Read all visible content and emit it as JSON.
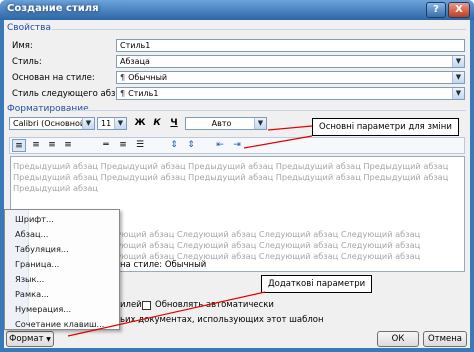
{
  "window": {
    "title": "Создание стиля",
    "help_label": "?",
    "close_label": "X"
  },
  "properties": {
    "section_title": "Свойства",
    "name_label": "Имя:",
    "name_value": "Стиль1",
    "type_label": "Стиль:",
    "type_value": "Абзаца",
    "based_on_label": "Основан на стиле:",
    "based_on_value": "Обычный",
    "next_label": "Стиль следующего абзаца:",
    "next_value": "Стиль1"
  },
  "formatting": {
    "section_title": "Форматирование",
    "font_value": "Calibri (Основной текс",
    "size_value": "11",
    "bold_label": "Ж",
    "italic_label": "К",
    "underline_label": "Ч",
    "color_value": "Авто"
  },
  "preview": {
    "previous_lines": [
      "Предыдущий абзац Предыдущий абзац Предыдущий абзац Предыдущий абзац Предыдущий абзац",
      "Предыдущий абзац Предыдущий абзац Предыдущий абзац Предыдущий абзац Предыдущий абзац",
      "Предыдущий абзац"
    ],
    "next_lines": [
      "Следующий абзац Следующий абзац Следующий абзац Следующий абзац Следующий абзац",
      "Следующий абзац Следующий абзац Следующий абзац Следующий абзац Следующий абзац",
      "Следующий абзац Следующий абзац Следующий абзац Следующий абзац Следующий абзац"
    ]
  },
  "description": "на стиле: Обычный",
  "options": {
    "add_to_quick_partial": "илей",
    "auto_update_label": "Обновлять автоматически",
    "documents_scope_label": "ьих документах, использующих этот шаблон"
  },
  "format_menu": {
    "items": [
      "Шрифт...",
      "Абзац...",
      "Табуляция...",
      "Граница...",
      "Язык...",
      "Рамка...",
      "Нумерация...",
      "Сочетание клавиш..."
    ]
  },
  "buttons": {
    "format_label": "Формат",
    "ok_label": "ОК",
    "cancel_label": "Отмена"
  },
  "annotations": {
    "main_params": "Основні параметри для зміни",
    "extra_params": "Додаткові параметри"
  },
  "colors": {
    "title_bar": "#2d66a6",
    "section_text": "#1f4ea3",
    "preview_text": "#a6a6a6",
    "annotation_arrow": "#e00000"
  }
}
